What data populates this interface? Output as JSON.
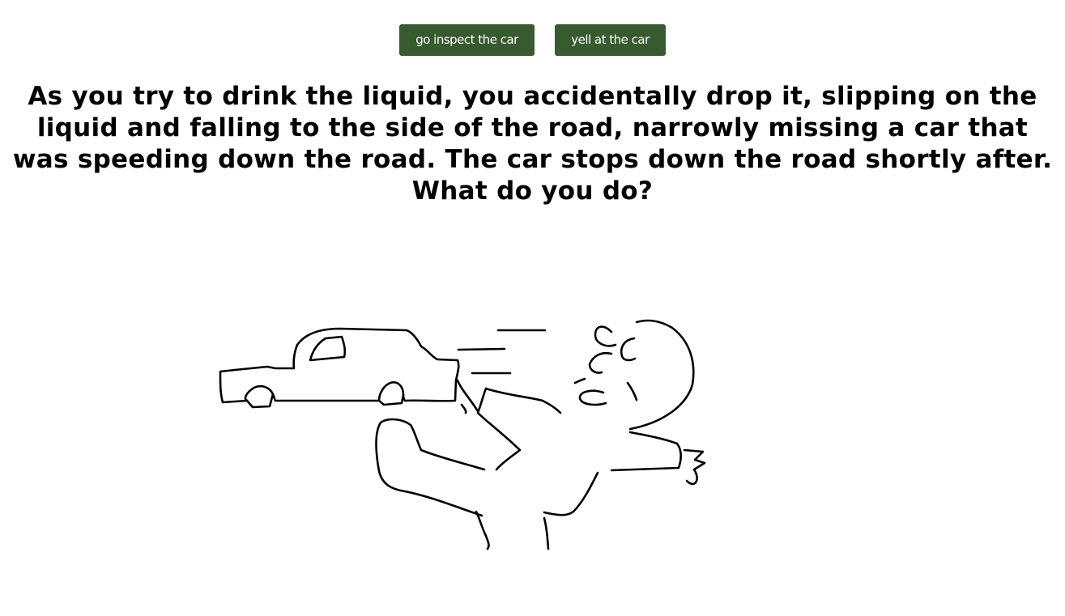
{
  "choices": [
    {
      "label": "go inspect the car"
    },
    {
      "label": "yell at the car"
    }
  ],
  "story": {
    "text": "As you try to drink the liquid, you accidentally drop it, slipping on the liquid and falling to the side of the road, narrowly missing a car that was speeding down the road. The car stops down the road shortly after. What do you do?"
  },
  "colors": {
    "button_bg": "#385a2f",
    "button_text": "#ffffff",
    "text": "#000000",
    "background": "#ffffff"
  }
}
